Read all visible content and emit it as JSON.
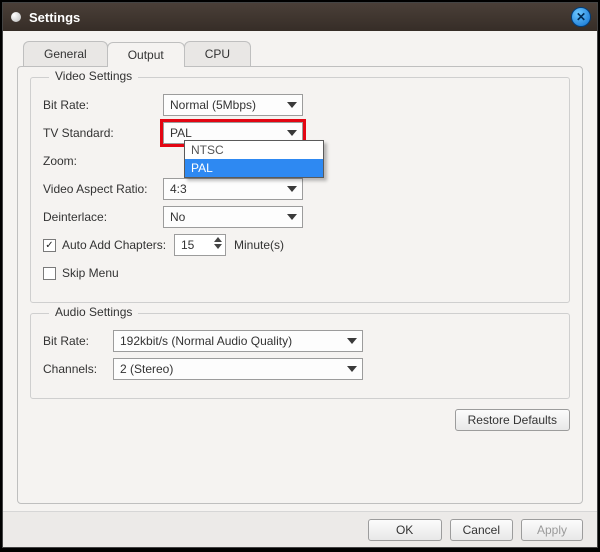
{
  "window": {
    "title": "Settings"
  },
  "tabs": {
    "general": "General",
    "output": "Output",
    "cpu": "CPU"
  },
  "videoGroup": {
    "legend": "Video Settings"
  },
  "audioGroup": {
    "legend": "Audio Settings"
  },
  "labels": {
    "bitrate": "Bit Rate:",
    "tvstd": "TV Standard:",
    "zoom": "Zoom:",
    "aspect": "Video Aspect Ratio:",
    "deinterlace": "Deinterlace:",
    "autochapters": "Auto Add Chapters:",
    "skipmenu": "Skip Menu",
    "minutes": "Minute(s)",
    "audiobitrate": "Bit Rate:",
    "channels": "Channels:"
  },
  "values": {
    "bitrate": "Normal (5Mbps)",
    "tvstd": "PAL",
    "zoom": "",
    "aspect": "4:3",
    "deinterlace": "No",
    "chapters_interval": "15",
    "autochapters_checked": "✓",
    "skipmenu_checked": "",
    "audiobitrate": "192kbit/s (Normal Audio Quality)",
    "channels": "2 (Stereo)"
  },
  "dropdown_open": {
    "opt0": "NTSC",
    "opt1": "PAL"
  },
  "buttons": {
    "restore": "Restore Defaults",
    "ok": "OK",
    "cancel": "Cancel",
    "apply": "Apply"
  }
}
